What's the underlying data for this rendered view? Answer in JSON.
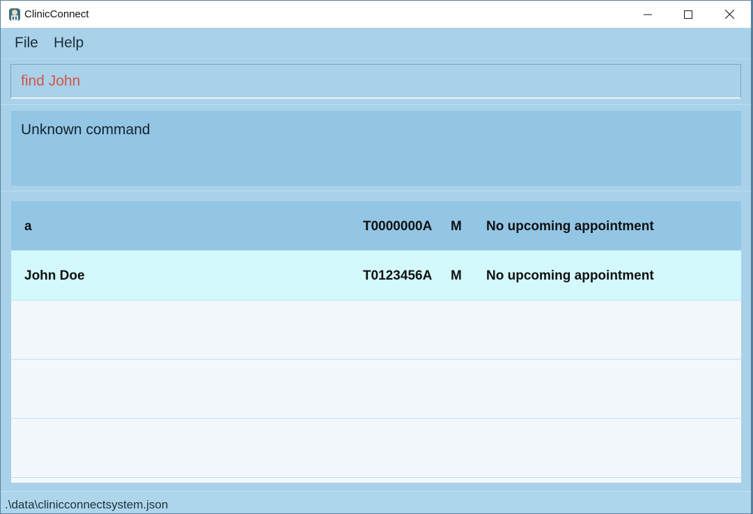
{
  "window": {
    "title": "ClinicConnect",
    "icon": "clinic-app-icon"
  },
  "menu": {
    "items": [
      {
        "label": "File"
      },
      {
        "label": "Help"
      }
    ]
  },
  "command": {
    "value": "find John"
  },
  "result": {
    "message": "Unknown command"
  },
  "patients": [
    {
      "name": "a",
      "nric": "T0000000A",
      "sex": "M",
      "appointment": "No upcoming appointment"
    },
    {
      "name": "John Doe",
      "nric": "T0123456A",
      "sex": "M",
      "appointment": "No upcoming appointment"
    }
  ],
  "status": {
    "file_path": ".\\data\\clinicconnectsystem.json"
  },
  "colors": {
    "command_text": "#d0574a",
    "selected_row": "#93c6e5",
    "alt_row": "#d3f9fd",
    "background": "#a9d1ea"
  }
}
